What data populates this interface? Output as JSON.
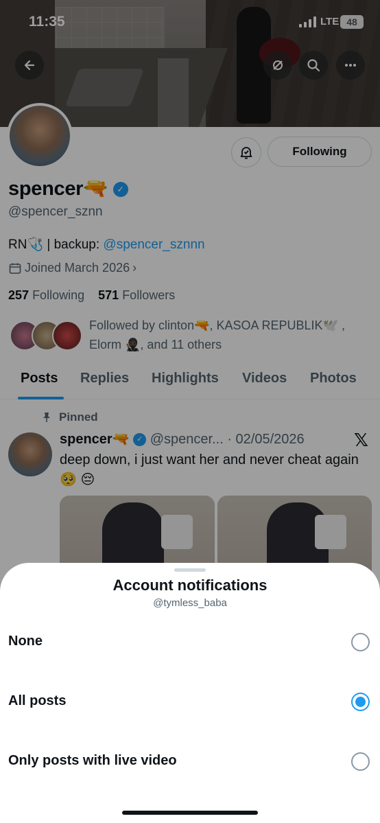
{
  "status_bar": {
    "time": "11:35",
    "network": "LTE",
    "battery": "48"
  },
  "profile": {
    "name": "spencer🔫",
    "handle": "@spencer_sznn",
    "bio_text": "RN🩺 | backup: ",
    "bio_link": "@spencer_sznnn",
    "joined": "Joined March 2026",
    "following_count": "257",
    "following_label": "Following",
    "followers_count": "571",
    "followers_label": "Followers",
    "followed_by": "Followed by clinton🔫, KASOA REPUBLIK🕊️ , Elorm 🥷🏿, and 11 others",
    "following_button": "Following"
  },
  "tabs": [
    "Posts",
    "Replies",
    "Highlights",
    "Videos",
    "Photos"
  ],
  "active_tab": "Posts",
  "post": {
    "pinned_label": "Pinned",
    "author": "spencer🔫",
    "handle_trunc": "@spencer...",
    "date": "· 02/05/2026",
    "text": "deep down, i just want her and never cheat again🥺 😔"
  },
  "sheet": {
    "title": "Account notifications",
    "subtitle": "@tymless_baba",
    "options": [
      {
        "label": "None",
        "selected": false
      },
      {
        "label": "All posts",
        "selected": true
      },
      {
        "label": "Only posts with live video",
        "selected": false
      }
    ]
  },
  "colors": {
    "accent": "#1d9bf0",
    "text": "#0f1419",
    "secondary": "#536471"
  }
}
